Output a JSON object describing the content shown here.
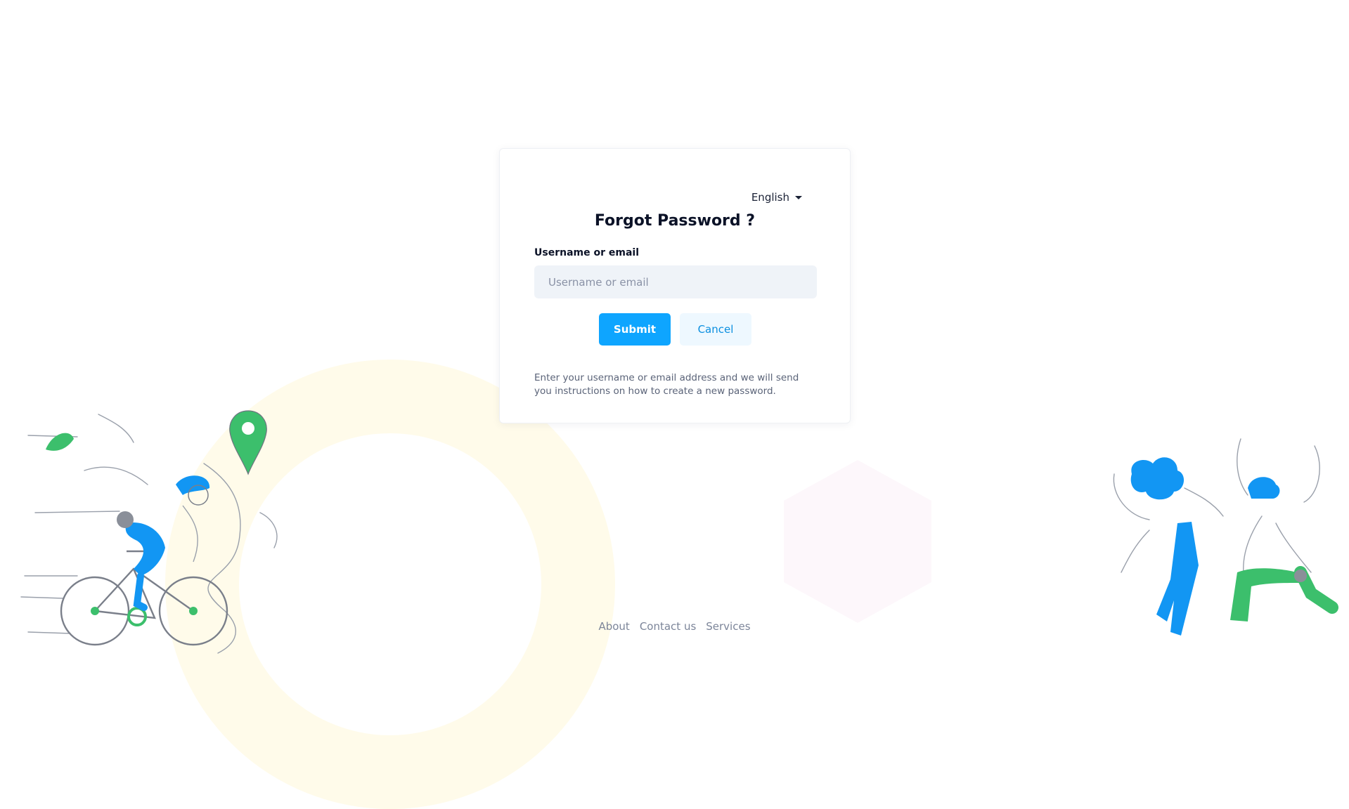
{
  "language": {
    "selected": "English"
  },
  "form": {
    "title": "Forgot Password ?",
    "field_label": "Username or email",
    "field_placeholder": "Username or email",
    "field_value": "",
    "submit_label": "Submit",
    "cancel_label": "Cancel",
    "help_text": "Enter your username or email address and we will send you instructions on how to create a new password."
  },
  "footer": {
    "links": [
      {
        "label": "About"
      },
      {
        "label": "Contact us"
      },
      {
        "label": "Services"
      }
    ]
  },
  "colors": {
    "primary": "#0ea5ff",
    "cancel_bg": "#eef8ff",
    "input_bg": "#eff3f8",
    "illustration_blue": "#1296f3",
    "illustration_green": "#3cbf6c"
  },
  "illustrations": {
    "left": "cyclist-with-map-pin-illustration",
    "right": "dancing-people-illustration"
  }
}
